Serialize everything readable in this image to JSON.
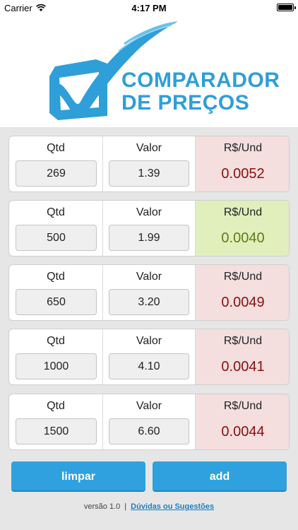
{
  "status_bar": {
    "carrier": "Carrier",
    "time": "4:17 PM",
    "icons": [
      "wifi-icon",
      "battery-icon"
    ]
  },
  "header": {
    "logo_line1": "COMPARADOR",
    "logo_line2": "DE PREÇOS",
    "logo_icon": "checkmark-box-icon",
    "brand_color": "#2e9fd8"
  },
  "columns": {
    "qtd": "Qtd",
    "valor": "Valor",
    "result": "R$/Und"
  },
  "rows": [
    {
      "qtd": "269",
      "valor": "1.39",
      "result": "0.0052",
      "status": "bad"
    },
    {
      "qtd": "500",
      "valor": "1.99",
      "result": "0.0040",
      "status": "good"
    },
    {
      "qtd": "650",
      "valor": "3.20",
      "result": "0.0049",
      "status": "bad"
    },
    {
      "qtd": "1000",
      "valor": "4.10",
      "result": "0.0041",
      "status": "bad"
    },
    {
      "qtd": "1500",
      "valor": "6.60",
      "result": "0.0044",
      "status": "bad"
    }
  ],
  "buttons": {
    "clear": "limpar",
    "add": "add"
  },
  "footer": {
    "version": "versão 1.0",
    "separator": "|",
    "link": "Dúvidas ou Sugestões"
  },
  "colors": {
    "accent": "#2fa1de",
    "best_bg": "#e0efbc",
    "best_text": "#5e7d12",
    "worse_bg": "#f4dede",
    "worse_text": "#8c0f0f"
  }
}
